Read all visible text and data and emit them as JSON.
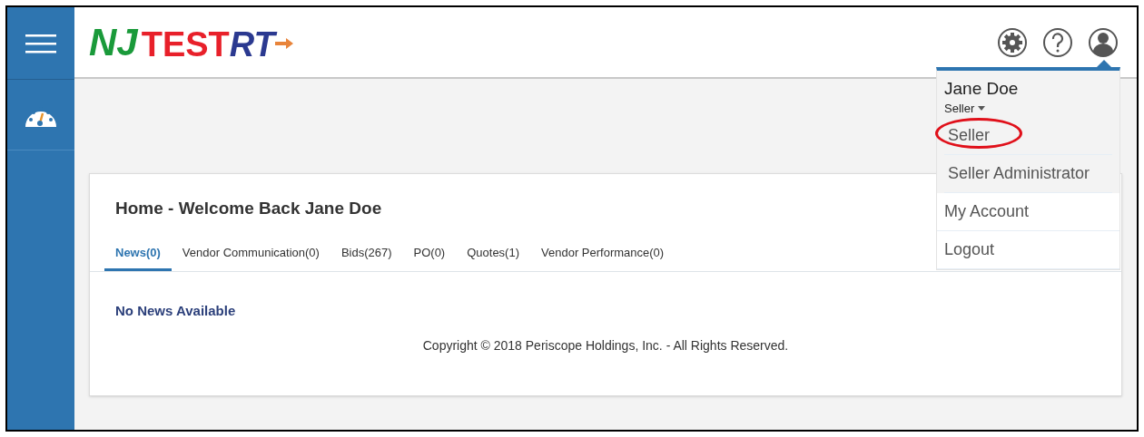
{
  "logo": {
    "brand": "NJ",
    "stamp": "TEST",
    "name_tail": "RT"
  },
  "user_menu": {
    "name": "Jane Doe",
    "role": "Seller",
    "roles": [
      {
        "label": "Seller",
        "highlighted": true
      },
      {
        "label": "Seller Administrator",
        "highlighted": false
      }
    ],
    "items": [
      "My Account",
      "Logout"
    ]
  },
  "card": {
    "title": "Home - Welcome Back Jane Doe",
    "tabs": [
      {
        "label": "News(0)",
        "selected": true
      },
      {
        "label": "Vendor Communication(0)",
        "selected": false
      },
      {
        "label": "Bids(267)",
        "selected": false
      },
      {
        "label": "PO(0)",
        "selected": false
      },
      {
        "label": "Quotes(1)",
        "selected": false
      },
      {
        "label": "Vendor Performance(0)",
        "selected": false
      }
    ],
    "message": "No News Available",
    "footer": "Copyright © 2018 Periscope Holdings, Inc. - All Rights Reserved."
  }
}
